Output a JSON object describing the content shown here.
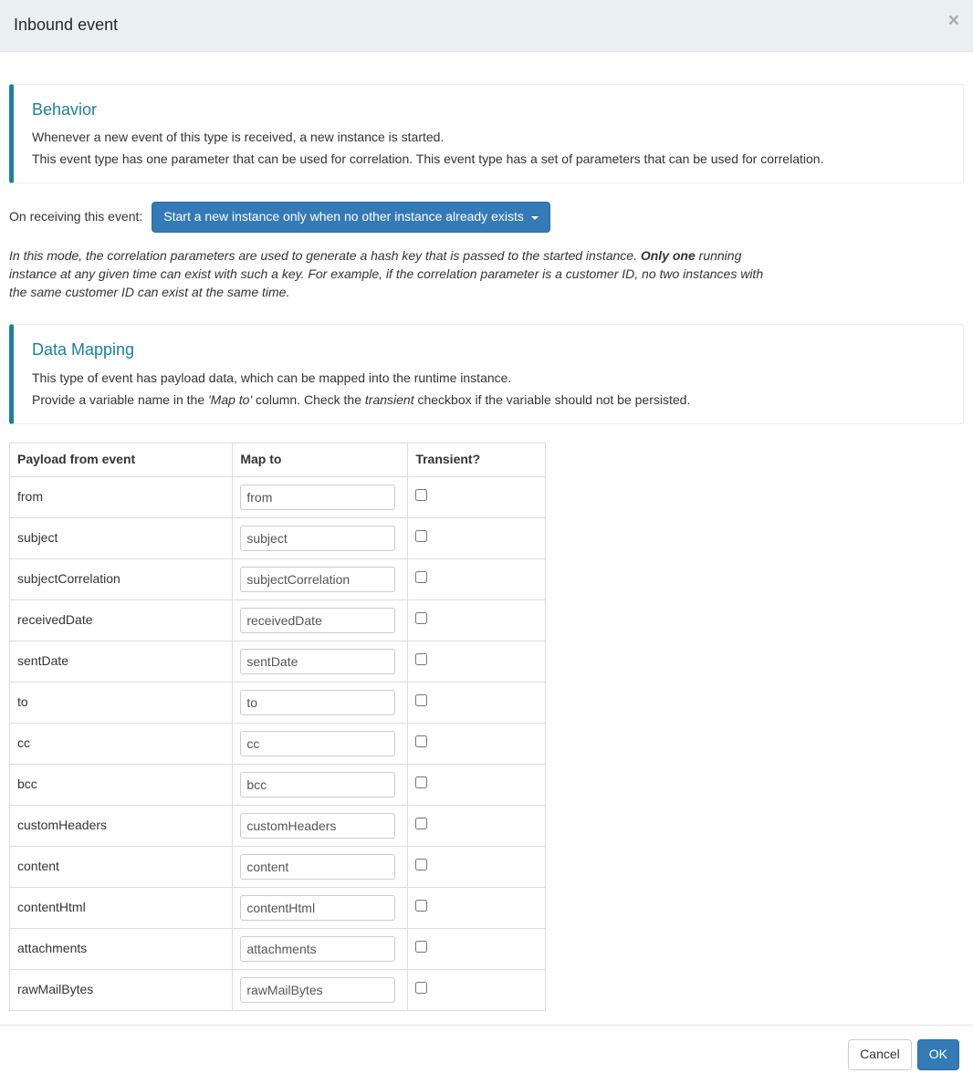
{
  "modal": {
    "title": "Inbound event",
    "close": "×"
  },
  "behavior": {
    "heading": "Behavior",
    "line1": "Whenever a new event of this type is received, a new instance is started.",
    "line2": "This event type has one parameter that can be used for correlation. This event type has a set of parameters that can be used for correlation."
  },
  "receive": {
    "label": "On receiving this event:",
    "selected": "Start a new instance only when no other instance already exists"
  },
  "modeDesc": {
    "pre": "In this mode, the correlation parameters are used to generate a hash key that is passed to the started instance. ",
    "bold": "Only one",
    "post": " running instance at any given time can exist with such a key. For example, if the correlation parameter is a customer ID, no two instances with the same customer ID can exist at the same time."
  },
  "dataMapping": {
    "heading": "Data Mapping",
    "line1": "This type of event has payload data, which can be mapped into the runtime instance.",
    "line2_pre": "Provide a variable name in the ",
    "line2_em1": "'Map to'",
    "line2_mid": " column. Check the ",
    "line2_em2": "transient",
    "line2_post": " checkbox if the variable should not be persisted."
  },
  "table": {
    "headers": {
      "payload": "Payload from event",
      "mapto": "Map to",
      "transient": "Transient?"
    },
    "rows": [
      {
        "payload": "from",
        "mapto": "from",
        "transient": false
      },
      {
        "payload": "subject",
        "mapto": "subject",
        "transient": false
      },
      {
        "payload": "subjectCorrelation",
        "mapto": "subjectCorrelation",
        "transient": false
      },
      {
        "payload": "receivedDate",
        "mapto": "receivedDate",
        "transient": false
      },
      {
        "payload": "sentDate",
        "mapto": "sentDate",
        "transient": false
      },
      {
        "payload": "to",
        "mapto": "to",
        "transient": false
      },
      {
        "payload": "cc",
        "mapto": "cc",
        "transient": false
      },
      {
        "payload": "bcc",
        "mapto": "bcc",
        "transient": false
      },
      {
        "payload": "customHeaders",
        "mapto": "customHeaders",
        "transient": false
      },
      {
        "payload": "content",
        "mapto": "content",
        "transient": false
      },
      {
        "payload": "contentHtml",
        "mapto": "contentHtml",
        "transient": false
      },
      {
        "payload": "attachments",
        "mapto": "attachments",
        "transient": false
      },
      {
        "payload": "rawMailBytes",
        "mapto": "rawMailBytes",
        "transient": false
      }
    ]
  },
  "footer": {
    "cancel": "Cancel",
    "ok": "OK"
  }
}
